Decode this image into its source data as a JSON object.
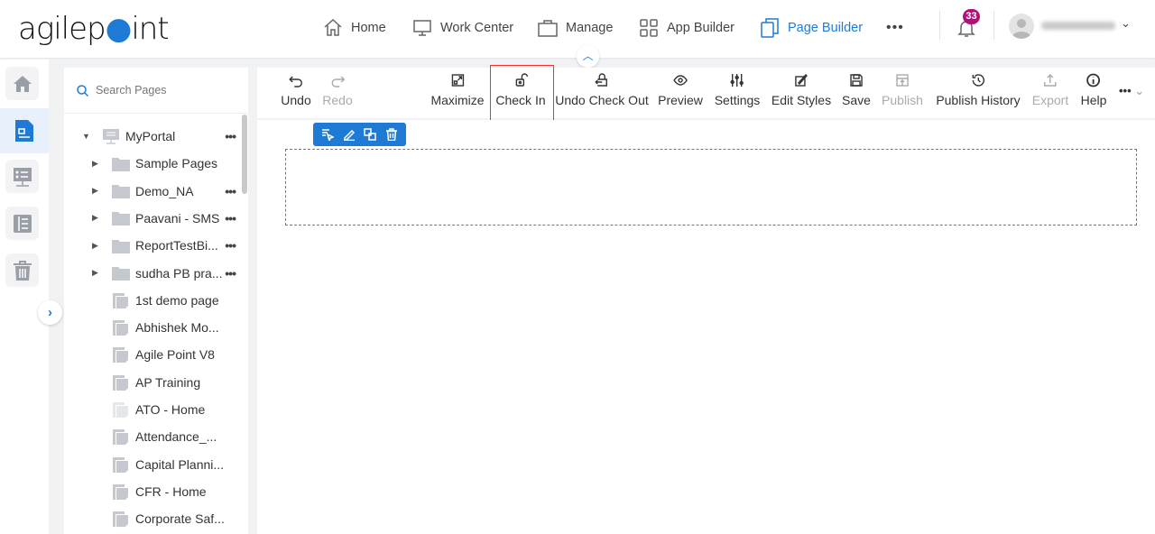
{
  "header": {
    "logo": "agilepoint",
    "nav": [
      {
        "label": "Home",
        "icon": "home-icon"
      },
      {
        "label": "Work Center",
        "icon": "monitor-icon"
      },
      {
        "label": "Manage",
        "icon": "briefcase-icon"
      },
      {
        "label": "App Builder",
        "icon": "grid-icon"
      },
      {
        "label": "Page Builder",
        "icon": "pages-icon",
        "active": true
      }
    ],
    "more": "•••",
    "notifications": "33",
    "accent": "#1f7ad6",
    "badge_color": "#b0127a"
  },
  "pages_panel": {
    "search_placeholder": "Search Pages",
    "tree": [
      {
        "label": "MyPortal",
        "type": "portal",
        "expanded": true,
        "more": true
      },
      {
        "label": "Sample Pages",
        "type": "folder"
      },
      {
        "label": "Demo_NA",
        "type": "folder",
        "more": true
      },
      {
        "label": "Paavani - SMS",
        "type": "folder",
        "more": true
      },
      {
        "label": "ReportTestBi...",
        "type": "folder",
        "more": true
      },
      {
        "label": "sudha PB pra...",
        "type": "folder",
        "more": true
      },
      {
        "label": "1st demo page",
        "type": "page"
      },
      {
        "label": "Abhishek Mo...",
        "type": "page"
      },
      {
        "label": "Agile Point V8",
        "type": "page"
      },
      {
        "label": "AP Training",
        "type": "page"
      },
      {
        "label": "ATO - Home",
        "type": "page",
        "faded": true
      },
      {
        "label": "Attendance_...",
        "type": "page"
      },
      {
        "label": "Capital Planni...",
        "type": "page"
      },
      {
        "label": "CFR - Home",
        "type": "page"
      },
      {
        "label": "Corporate Saf...",
        "type": "page"
      }
    ]
  },
  "toolbar": {
    "items": [
      {
        "label": "Undo",
        "icon": "undo-icon"
      },
      {
        "label": "Redo",
        "icon": "redo-icon",
        "disabled": true
      },
      {
        "label": "Maximize",
        "icon": "maximize-icon"
      },
      {
        "label": "Check In",
        "icon": "unlock-icon",
        "highlighted": true
      },
      {
        "label": "Undo Check Out",
        "icon": "undo-checkout-icon"
      },
      {
        "label": "Preview",
        "icon": "eye-icon"
      },
      {
        "label": "Settings",
        "icon": "sliders-icon"
      },
      {
        "label": "Edit Styles",
        "icon": "edit-styles-icon"
      },
      {
        "label": "Save",
        "icon": "save-icon"
      },
      {
        "label": "Publish",
        "icon": "publish-icon",
        "disabled": true
      },
      {
        "label": "Publish History",
        "icon": "history-icon"
      },
      {
        "label": "Export",
        "icon": "export-icon",
        "disabled": true
      },
      {
        "label": "Help",
        "icon": "info-icon"
      }
    ],
    "more": "•••"
  }
}
